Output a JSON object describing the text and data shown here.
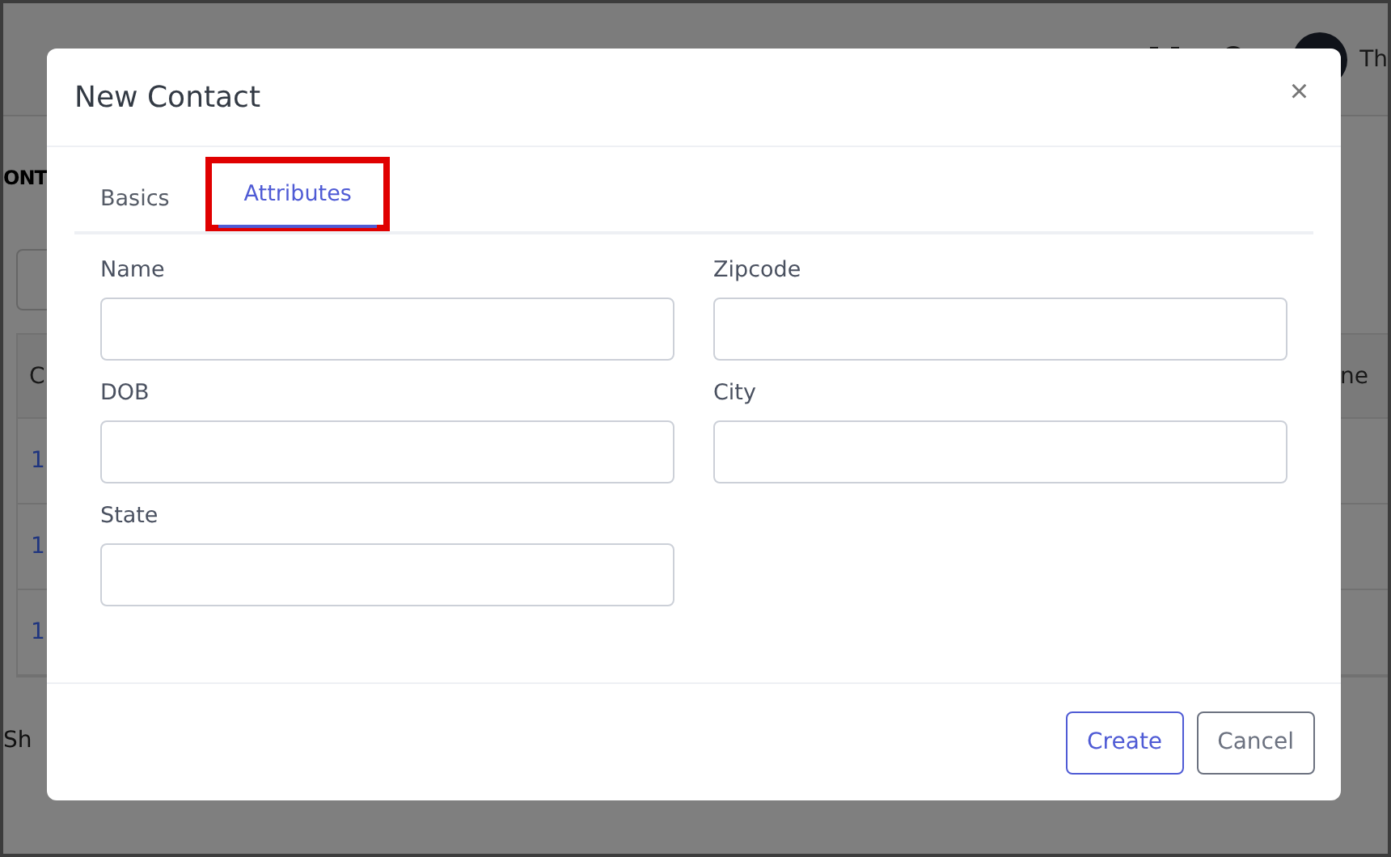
{
  "background": {
    "user_name": "Th",
    "section_title": "ONT",
    "table_header": [
      "C",
      "ne"
    ],
    "table_rows": [
      "1",
      "1",
      "1"
    ],
    "footer_text": "Sh"
  },
  "dialog": {
    "title": "New Contact",
    "close": "×",
    "tabs": [
      {
        "label": "Basics",
        "selected": false,
        "highlighted": false
      },
      {
        "label": "Attributes",
        "selected": true,
        "highlighted": true
      }
    ],
    "fields": [
      {
        "label": "Name"
      },
      {
        "label": "Zipcode"
      },
      {
        "label": "DOB"
      },
      {
        "label": "City"
      },
      {
        "label": "State"
      }
    ],
    "buttons": [
      {
        "label": "Create",
        "kind": "primary"
      },
      {
        "label": "Cancel",
        "kind": "secondary"
      }
    ]
  }
}
